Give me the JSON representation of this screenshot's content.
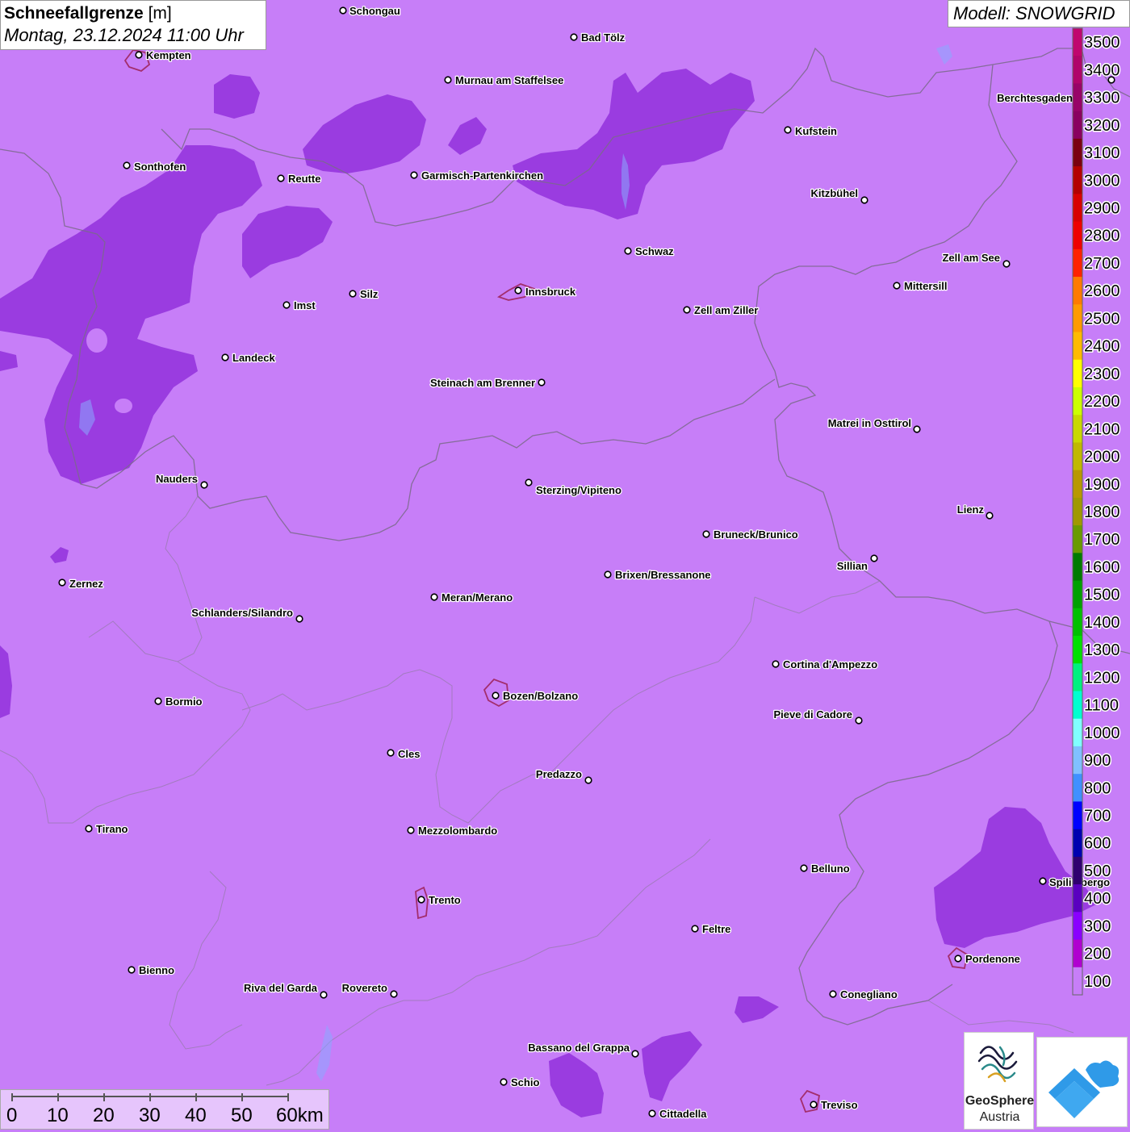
{
  "header": {
    "title_bold": "Schneefallgrenze",
    "title_unit": " [m]",
    "datetime": "Montag, 23.12.2024 11:00 Uhr",
    "model": "Modell: SNOWGRID"
  },
  "colors": {
    "background": "#c77ef8",
    "snow_area": "#9a3ce0",
    "border_line": "#7a6a8a"
  },
  "legend": {
    "values": [
      3500,
      3400,
      3300,
      3200,
      3100,
      3000,
      2900,
      2800,
      2700,
      2600,
      2500,
      2400,
      2300,
      2200,
      2100,
      2000,
      1900,
      1800,
      1700,
      1600,
      1500,
      1400,
      1300,
      1200,
      1100,
      1000,
      900,
      800,
      700,
      600,
      500,
      400,
      300,
      200,
      100
    ],
    "colors": [
      "#c0066f",
      "#b0056a",
      "#980468",
      "#8a0060",
      "#7a0010",
      "#b40000",
      "#d80000",
      "#ee0000",
      "#ff2200",
      "#ff7a00",
      "#ff9a00",
      "#ffba00",
      "#ffff00",
      "#ccff00",
      "#c8d800",
      "#c0b800",
      "#b89800",
      "#a09800",
      "#6a9a00",
      "#007a00",
      "#00a000",
      "#00c000",
      "#00e000",
      "#00f080",
      "#00ffd0",
      "#80ffff",
      "#80c0ff",
      "#4090ff",
      "#0000ff",
      "#0000b0",
      "#300070",
      "#5a00c0",
      "#8a00ff",
      "#b000d0",
      "#c77ef8"
    ]
  },
  "cities": [
    {
      "name": "Schongau",
      "dot": [
        425,
        13
      ],
      "label": [
        433,
        18
      ],
      "anchor": "start"
    },
    {
      "name": "Kempten",
      "dot": [
        172,
        68
      ],
      "label": [
        181,
        73
      ],
      "anchor": "start"
    },
    {
      "name": "Bad Tölz",
      "dot": [
        711,
        46
      ],
      "label": [
        720,
        51
      ],
      "anchor": "start"
    },
    {
      "name": "Murnau am Staffelsee",
      "dot": [
        555,
        99
      ],
      "label": [
        564,
        104
      ],
      "anchor": "start"
    },
    {
      "name": "Berchtesgaden",
      "dot": [
        1377,
        99
      ],
      "label": [
        1329,
        126
      ],
      "anchor": "end"
    },
    {
      "name": "Kufstein",
      "dot": [
        976,
        161
      ],
      "label": [
        985,
        167
      ],
      "anchor": "start"
    },
    {
      "name": "Sonthofen",
      "dot": [
        157,
        205
      ],
      "label": [
        166,
        211
      ],
      "anchor": "start"
    },
    {
      "name": "Reutte",
      "dot": [
        348,
        221
      ],
      "label": [
        357,
        226
      ],
      "anchor": "start"
    },
    {
      "name": "Garmisch-Partenkirchen",
      "dot": [
        513,
        217
      ],
      "label": [
        522,
        222
      ],
      "anchor": "start"
    },
    {
      "name": "Kitzbühel",
      "dot": [
        1071,
        248
      ],
      "label": [
        1063,
        244
      ],
      "anchor": "end"
    },
    {
      "name": "Schwaz",
      "dot": [
        778,
        311
      ],
      "label": [
        787,
        316
      ],
      "anchor": "start"
    },
    {
      "name": "Zell am See",
      "dot": [
        1247,
        327
      ],
      "label": [
        1239,
        324
      ],
      "anchor": "end"
    },
    {
      "name": "Mittersill",
      "dot": [
        1111,
        354
      ],
      "label": [
        1120,
        359
      ],
      "anchor": "start"
    },
    {
      "name": "Innsbruck",
      "dot": [
        642,
        360
      ],
      "label": [
        651,
        366
      ],
      "anchor": "start"
    },
    {
      "name": "Silz",
      "dot": [
        437,
        364
      ],
      "label": [
        446,
        369
      ],
      "anchor": "start"
    },
    {
      "name": "Imst",
      "dot": [
        355,
        378
      ],
      "label": [
        364,
        383
      ],
      "anchor": "start"
    },
    {
      "name": "Zell am Ziller",
      "dot": [
        851,
        384
      ],
      "label": [
        860,
        389
      ],
      "anchor": "start"
    },
    {
      "name": "Landeck",
      "dot": [
        279,
        443
      ],
      "label": [
        288,
        448
      ],
      "anchor": "start"
    },
    {
      "name": "Steinach am Brenner",
      "dot": [
        671,
        474
      ],
      "label": [
        663,
        479
      ],
      "anchor": "end"
    },
    {
      "name": "Matrei in Osttirol",
      "dot": [
        1136,
        532
      ],
      "label": [
        1129,
        529
      ],
      "anchor": "end"
    },
    {
      "name": "Nauders",
      "dot": [
        253,
        601
      ],
      "label": [
        245,
        598
      ],
      "anchor": "end"
    },
    {
      "name": "Sterzing/Vipiteno",
      "dot": [
        655,
        598
      ],
      "label": [
        664,
        612
      ],
      "anchor": "start"
    },
    {
      "name": "Lienz",
      "dot": [
        1226,
        639
      ],
      "label": [
        1219,
        636
      ],
      "anchor": "end"
    },
    {
      "name": "Bruneck/Brunico",
      "dot": [
        875,
        662
      ],
      "label": [
        884,
        667
      ],
      "anchor": "start"
    },
    {
      "name": "Sillian",
      "dot": [
        1083,
        692
      ],
      "label": [
        1075,
        706
      ],
      "anchor": "end"
    },
    {
      "name": "Brixen/Bressanone",
      "dot": [
        753,
        712
      ],
      "label": [
        762,
        717
      ],
      "anchor": "start"
    },
    {
      "name": "Zernez",
      "dot": [
        77,
        722
      ],
      "label": [
        86,
        728
      ],
      "anchor": "start"
    },
    {
      "name": "Meran/Merano",
      "dot": [
        538,
        740
      ],
      "label": [
        547,
        745
      ],
      "anchor": "start"
    },
    {
      "name": "Schlanders/Silandro",
      "dot": [
        371,
        767
      ],
      "label": [
        363,
        764
      ],
      "anchor": "end"
    },
    {
      "name": "Cortina d'Ampezzo",
      "dot": [
        961,
        823
      ],
      "label": [
        970,
        828
      ],
      "anchor": "start"
    },
    {
      "name": "Bozen/Bolzano",
      "dot": [
        614,
        862
      ],
      "label": [
        623,
        867
      ],
      "anchor": "start"
    },
    {
      "name": "Bormio",
      "dot": [
        196,
        869
      ],
      "label": [
        205,
        874
      ],
      "anchor": "start"
    },
    {
      "name": "Pieve di Cadore",
      "dot": [
        1064,
        893
      ],
      "label": [
        1056,
        890
      ],
      "anchor": "end"
    },
    {
      "name": "Cles",
      "dot": [
        484,
        933
      ],
      "label": [
        493,
        939
      ],
      "anchor": "start"
    },
    {
      "name": "Predazzo",
      "dot": [
        729,
        967
      ],
      "label": [
        721,
        964
      ],
      "anchor": "end"
    },
    {
      "name": "Tirano",
      "dot": [
        110,
        1027
      ],
      "label": [
        119,
        1032
      ],
      "anchor": "start"
    },
    {
      "name": "Mezzolombardo",
      "dot": [
        509,
        1029
      ],
      "label": [
        518,
        1034
      ],
      "anchor": "start"
    },
    {
      "name": "Belluno",
      "dot": [
        996,
        1076
      ],
      "label": [
        1005,
        1081
      ],
      "anchor": "start"
    },
    {
      "name": "Spilimbergo",
      "dot": [
        1292,
        1092
      ],
      "label": [
        1300,
        1098
      ],
      "anchor": "start"
    },
    {
      "name": "Trento",
      "dot": [
        522,
        1115
      ],
      "label": [
        531,
        1120
      ],
      "anchor": "start"
    },
    {
      "name": "Feltre",
      "dot": [
        861,
        1151
      ],
      "label": [
        870,
        1156
      ],
      "anchor": "start"
    },
    {
      "name": "Pordenone",
      "dot": [
        1187,
        1188
      ],
      "label": [
        1196,
        1193
      ],
      "anchor": "start"
    },
    {
      "name": "Bienno",
      "dot": [
        163,
        1202
      ],
      "label": [
        172,
        1207
      ],
      "anchor": "start"
    },
    {
      "name": "Riva del Garda",
      "dot": [
        401,
        1233
      ],
      "label": [
        393,
        1229
      ],
      "anchor": "end"
    },
    {
      "name": "Rovereto",
      "dot": [
        488,
        1232
      ],
      "label": [
        480,
        1229
      ],
      "anchor": "end"
    },
    {
      "name": "Conegliano",
      "dot": [
        1032,
        1232
      ],
      "label": [
        1041,
        1237
      ],
      "anchor": "start"
    },
    {
      "name": "Bassano del Grappa",
      "dot": [
        787,
        1306
      ],
      "label": [
        780,
        1303
      ],
      "anchor": "end"
    },
    {
      "name": "Schio",
      "dot": [
        624,
        1341
      ],
      "label": [
        633,
        1346
      ],
      "anchor": "start"
    },
    {
      "name": "Treviso",
      "dot": [
        1008,
        1369
      ],
      "label": [
        1017,
        1374
      ],
      "anchor": "start"
    },
    {
      "name": "Cittadella",
      "dot": [
        808,
        1380
      ],
      "label": [
        817,
        1385
      ],
      "anchor": "start"
    }
  ],
  "scale_bar": {
    "labels": [
      "0",
      "10",
      "20",
      "30",
      "40",
      "50",
      "60km"
    ]
  },
  "logos": {
    "geosphere_line1": "GeoSphere",
    "geosphere_line2": "Austria"
  }
}
